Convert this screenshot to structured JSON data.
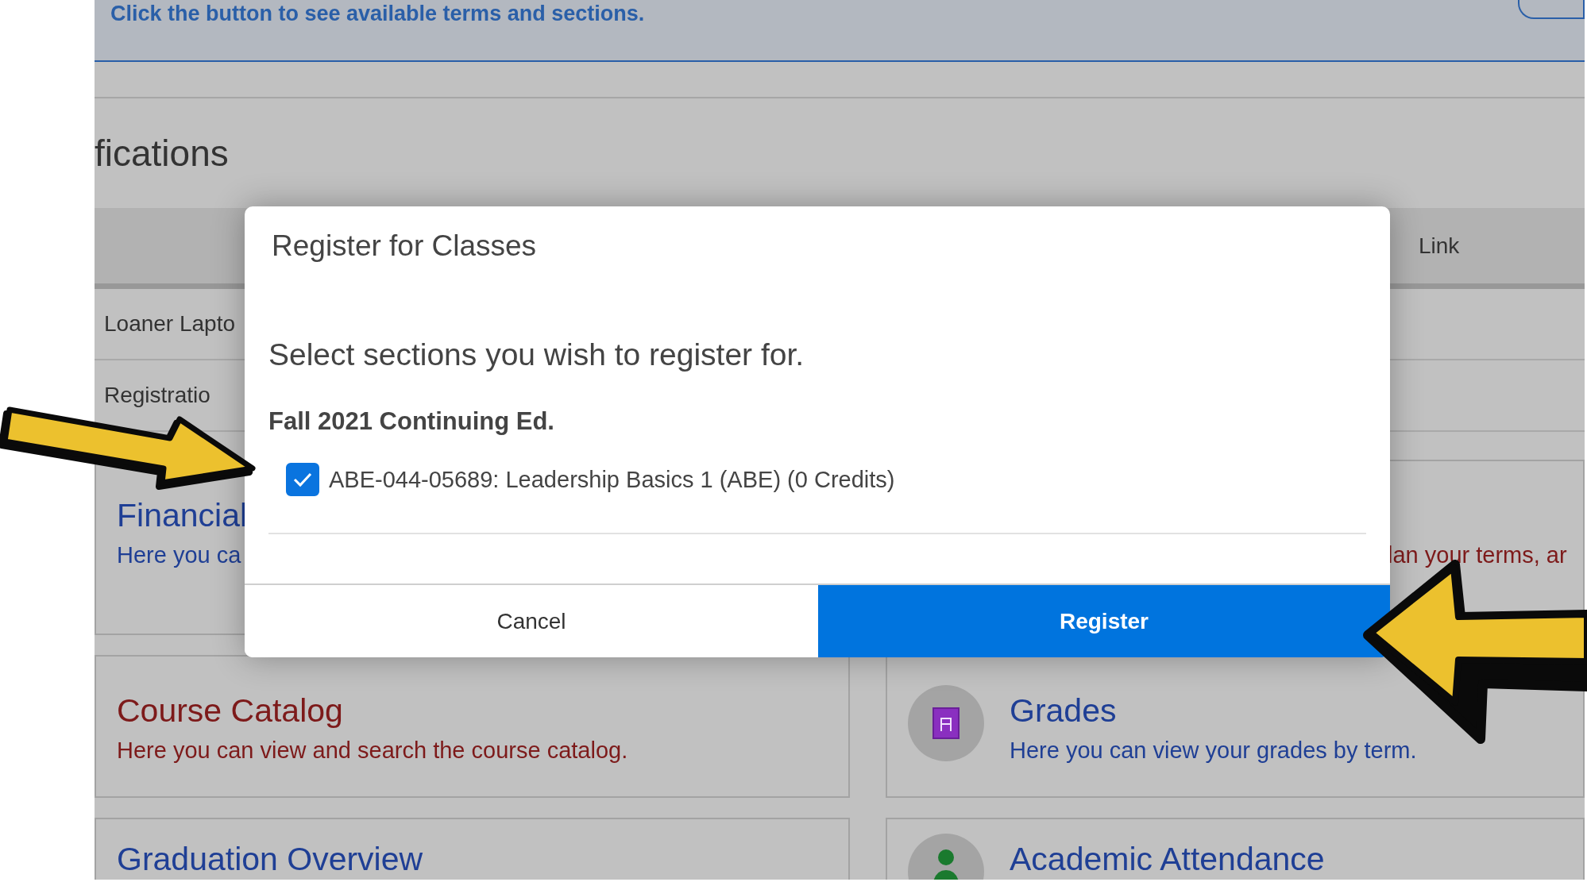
{
  "banner": {
    "text": "Click the button to see available terms and sections."
  },
  "section": {
    "heading": "fications",
    "header": {
      "link_column": "Link"
    },
    "rows": [
      "Loaner Lapto",
      "Registratio"
    ]
  },
  "cards": [
    {
      "title": "Financial",
      "description": "Here you ca",
      "color": "#1f3f95",
      "kind": "plain"
    },
    {
      "description": "lan your terms, ar",
      "color": "#7d1a1a",
      "kind": "hidden-title"
    },
    {
      "title": "Course Catalog",
      "description": "Here you can view and search the course catalog.",
      "color": "#7d1a1a",
      "kind": "plain"
    },
    {
      "title": "Grades",
      "description": "Here you can view your grades by term.",
      "color": "#1f3f95",
      "kind": "badge"
    },
    {
      "title": "Graduation Overview",
      "color": "#1f3f95",
      "kind": "plain"
    },
    {
      "title": "Academic Attendance",
      "color": "#1f3f95",
      "kind": "person"
    }
  ],
  "dialog": {
    "title": "Register for Classes",
    "prompt": "Select sections you wish to register for.",
    "term": "Fall 2021 Continuing Ed.",
    "sections": [
      {
        "label": "ABE-044-05689: Leadership Basics 1 (ABE) (0 Credits)",
        "checked": true
      }
    ],
    "buttons": [
      {
        "label": "Cancel",
        "kind": "secondary"
      },
      {
        "label": "Register",
        "kind": "primary"
      }
    ]
  }
}
